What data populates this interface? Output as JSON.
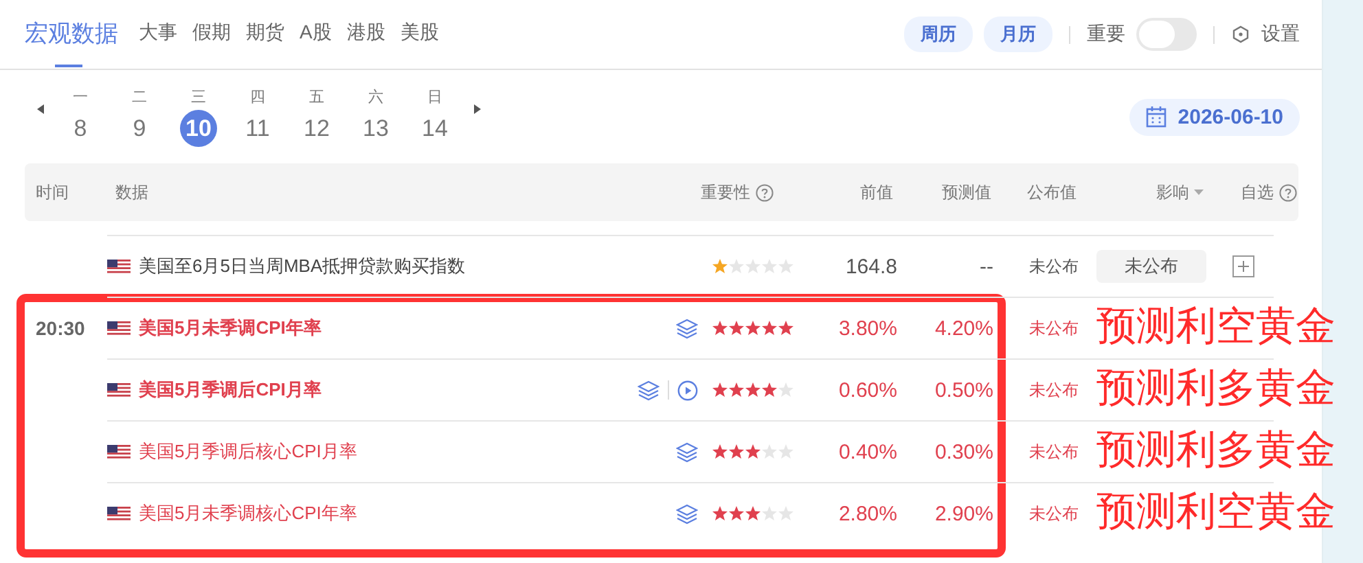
{
  "tabs": [
    {
      "label": "宏观数据",
      "selected": true
    },
    {
      "label": "大事",
      "selected": false
    },
    {
      "label": "假期",
      "selected": false
    },
    {
      "label": "期货",
      "selected": false
    },
    {
      "label": "A股",
      "selected": false
    },
    {
      "label": "港股",
      "selected": false
    },
    {
      "label": "美股",
      "selected": false
    }
  ],
  "view_buttons": [
    "周历",
    "月历"
  ],
  "important_toggle": {
    "label": "重要",
    "on": false
  },
  "settings": {
    "label": "设置"
  },
  "days": [
    {
      "weekday": "一",
      "day": "8",
      "selected": false
    },
    {
      "weekday": "二",
      "day": "9",
      "selected": false
    },
    {
      "weekday": "三",
      "day": "10",
      "selected": true
    },
    {
      "weekday": "四",
      "day": "11",
      "selected": false
    },
    {
      "weekday": "五",
      "day": "12",
      "selected": false
    },
    {
      "weekday": "六",
      "day": "13",
      "selected": false
    },
    {
      "weekday": "日",
      "day": "14",
      "selected": false
    }
  ],
  "date_button": "2026-06-10",
  "table": {
    "columns": [
      {
        "label": "时间",
        "kind": "plain"
      },
      {
        "label": "数据",
        "kind": "plain"
      },
      {
        "label": "重要性",
        "kind": "help"
      },
      {
        "label": "前值",
        "kind": "plain"
      },
      {
        "label": "预测值",
        "kind": "plain"
      },
      {
        "label": "公布值",
        "kind": "plain"
      },
      {
        "label": "影响",
        "kind": "sort"
      },
      {
        "label": "自选",
        "kind": "help"
      }
    ],
    "rows": [
      {
        "name": "美国至6月5日当周MBA抵押贷款购买指数",
        "stars": 1,
        "alert": false,
        "bold": false,
        "layers": false,
        "video": false,
        "previous": "164.8",
        "forecast": "--",
        "published": "未公布",
        "impact": "未公布"
      },
      {
        "time": "20:30",
        "name": "美国5月未季调CPI年率",
        "stars": 5,
        "alert": true,
        "bold": true,
        "layers": true,
        "video": false,
        "previous": "3.80%",
        "forecast": "4.20%",
        "published": "未公布",
        "annotation": "预测利空黄金"
      },
      {
        "name": "美国5月季调后CPI月率",
        "stars": 4,
        "alert": true,
        "bold": true,
        "layers": true,
        "video": true,
        "previous": "0.60%",
        "forecast": "0.50%",
        "published": "未公布",
        "annotation": "预测利多黄金"
      },
      {
        "name": "美国5月季调后核心CPI月率",
        "stars": 3,
        "alert": true,
        "bold": false,
        "layers": true,
        "video": false,
        "previous": "0.40%",
        "forecast": "0.30%",
        "published": "未公布",
        "annotation": "预测利多黄金"
      },
      {
        "name": "美国5月未季调核心CPI年率",
        "stars": 3,
        "alert": true,
        "bold": false,
        "layers": true,
        "video": false,
        "previous": "2.80%",
        "forecast": "2.90%",
        "published": "未公布",
        "annotation": "预测利空黄金"
      }
    ]
  }
}
